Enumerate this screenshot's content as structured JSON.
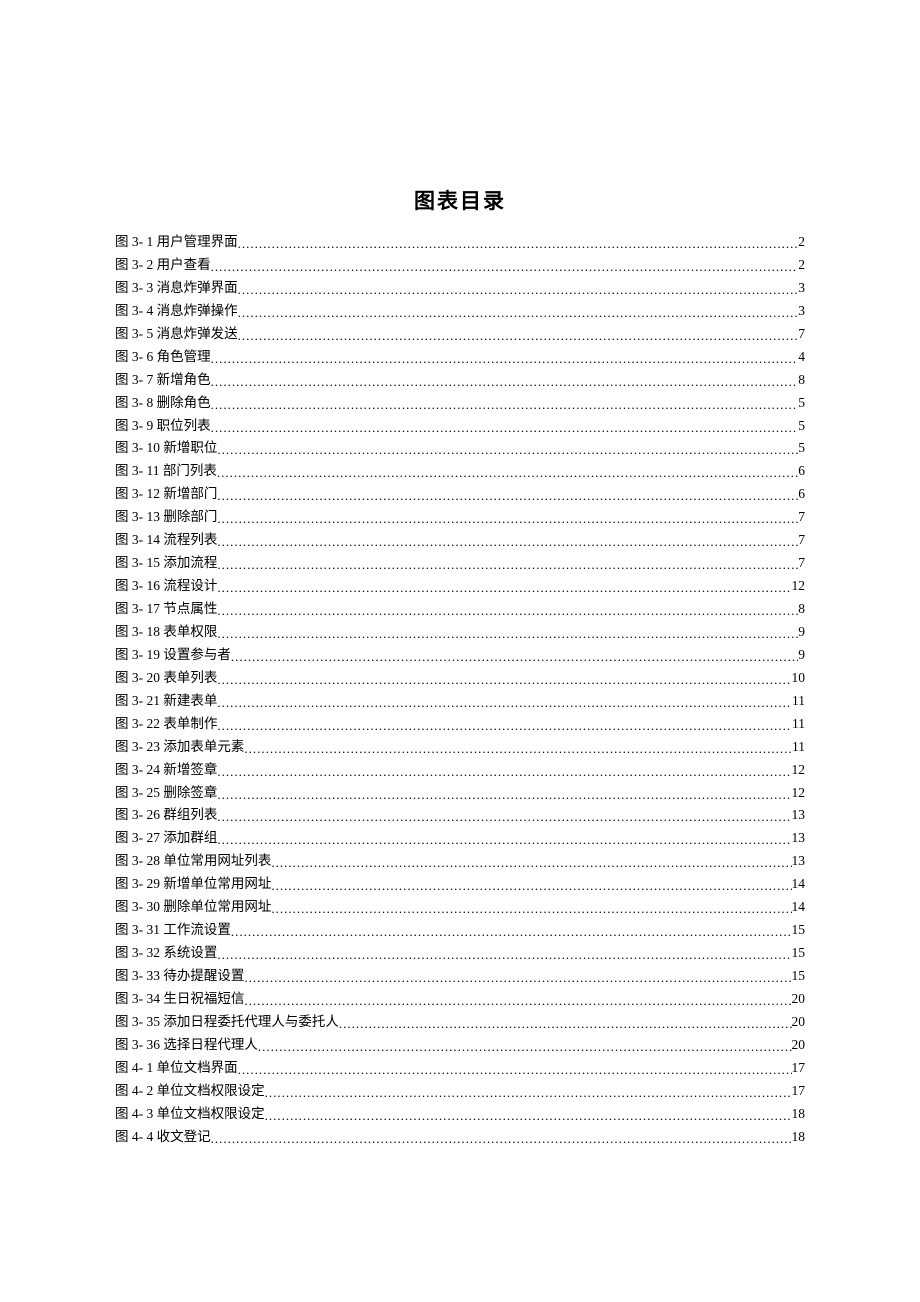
{
  "title": "图表目录",
  "entries": [
    {
      "label": "图 3- 1 用户管理界面",
      "page": "2"
    },
    {
      "label": "图 3- 2  用户查看",
      "page": "2"
    },
    {
      "label": "图 3- 3 消息炸弹界面",
      "page": "3"
    },
    {
      "label": "图 3- 4 消息炸弹操作",
      "page": "3"
    },
    {
      "label": "图 3- 5 消息炸弹发送",
      "page": "7"
    },
    {
      "label": "图 3- 6 角色管理",
      "page": "4"
    },
    {
      "label": "图 3- 7 新增角色",
      "page": "8"
    },
    {
      "label": "图 3- 8 删除角色",
      "page": "5"
    },
    {
      "label": "图 3- 9 职位列表",
      "page": "5"
    },
    {
      "label": "图 3- 10 新增职位",
      "page": "5"
    },
    {
      "label": "图 3- 11 部门列表",
      "page": "6"
    },
    {
      "label": "图 3- 12 新增部门",
      "page": "6"
    },
    {
      "label": "图 3- 13 删除部门",
      "page": "7"
    },
    {
      "label": "图 3- 14 流程列表",
      "page": "7"
    },
    {
      "label": "图 3- 15 添加流程",
      "page": "7"
    },
    {
      "label": "图 3- 16 流程设计",
      "page": "12"
    },
    {
      "label": "图 3- 17 节点属性",
      "page": "8"
    },
    {
      "label": "图 3- 18 表单权限",
      "page": "9"
    },
    {
      "label": "图 3- 19 设置参与者",
      "page": "9"
    },
    {
      "label": "图 3- 20 表单列表",
      "page": "10"
    },
    {
      "label": "图 3- 21 新建表单",
      "page": "11"
    },
    {
      "label": "图 3- 22 表单制作",
      "page": "11"
    },
    {
      "label": "图 3- 23 添加表单元素",
      "page": "11"
    },
    {
      "label": "图 3- 24 新增签章",
      "page": "12"
    },
    {
      "label": "图 3- 25 删除签章",
      "page": "12"
    },
    {
      "label": "图 3- 26 群组列表",
      "page": "13"
    },
    {
      "label": "图 3- 27 添加群组",
      "page": "13"
    },
    {
      "label": "图 3- 28 单位常用网址列表",
      "page": "13"
    },
    {
      "label": "图 3- 29 新增单位常用网址",
      "page": "14"
    },
    {
      "label": "图 3- 30 删除单位常用网址",
      "page": "14"
    },
    {
      "label": "图 3- 31 工作流设置",
      "page": "15"
    },
    {
      "label": "图 3- 32 系统设置",
      "page": "15"
    },
    {
      "label": "图 3- 33 待办提醒设置",
      "page": "15"
    },
    {
      "label": "图 3- 34 生日祝福短信",
      "page": "20"
    },
    {
      "label": "图 3- 35 添加日程委托代理人与委托人",
      "page": "20"
    },
    {
      "label": "图 3- 36 选择日程代理人",
      "page": "20"
    },
    {
      "label": "图 4- 1 单位文档界面",
      "page": "17"
    },
    {
      "label": "图 4- 2 单位文档权限设定",
      "page": "17"
    },
    {
      "label": "图 4- 3 单位文档权限设定",
      "page": "18"
    },
    {
      "label": "图 4- 4 收文登记",
      "page": "18"
    }
  ]
}
